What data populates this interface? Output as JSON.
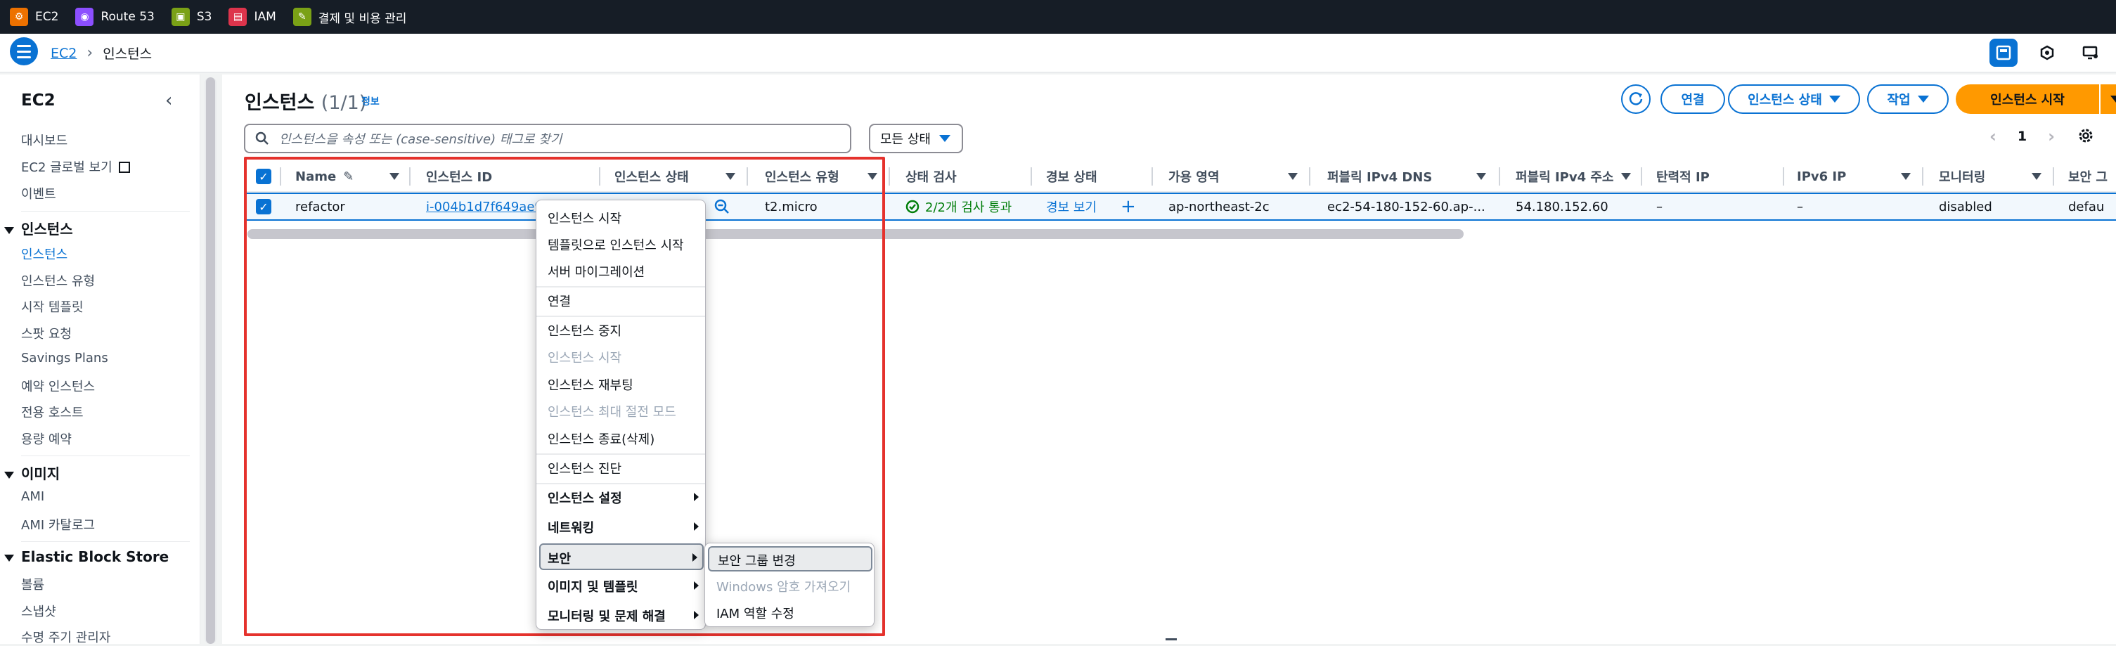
{
  "topbar": {
    "favorites": [
      {
        "label": "EC2",
        "icon": "ec2-icon",
        "color": "#ed7100"
      },
      {
        "label": "Route 53",
        "icon": "route53-icon",
        "color": "#8c4fff"
      },
      {
        "label": "S3",
        "icon": "s3-icon",
        "color": "#7aa116"
      },
      {
        "label": "IAM",
        "icon": "iam-icon",
        "color": "#dd344c"
      },
      {
        "label": "결제 및 비용 관리",
        "icon": "billing-icon",
        "color": "#7aa116"
      }
    ]
  },
  "breadcrumb": {
    "root": "EC2",
    "current": "인스턴스"
  },
  "sidebar": {
    "title": "EC2",
    "top_items": [
      "대시보드",
      "EC2 글로벌 보기",
      "이벤트"
    ],
    "sections": [
      {
        "header": "인스턴스",
        "items": [
          "인스턴스",
          "인스턴스 유형",
          "시작 템플릿",
          "스팟 요청",
          "Savings Plans",
          "예약 인스턴스",
          "전용 호스트",
          "용량 예약"
        ]
      },
      {
        "header": "이미지",
        "items": [
          "AMI",
          "AMI 카탈로그"
        ]
      },
      {
        "header": "Elastic Block Store",
        "items": [
          "볼륨",
          "스냅샷",
          "수명 주기 관리자"
        ]
      }
    ],
    "active": "인스턴스"
  },
  "main": {
    "title": "인스턴스",
    "count": "(1/1)",
    "info": "정보",
    "buttons": {
      "connect": "연결",
      "instance_state": "인스턴스 상태",
      "actions": "작업",
      "launch": "인스턴스 시작"
    },
    "search_placeholder": "인스턴스을 속성 또는 (case-sensitive) 태그로 찾기",
    "state_filter": "모든 상태",
    "page": "1"
  },
  "table": {
    "columns": [
      "Name",
      "인스턴스 ID",
      "인스턴스 상태",
      "인스턴스 유형",
      "상태 검사",
      "경보 상태",
      "가용 영역",
      "퍼블릭 IPv4 DNS",
      "퍼블릭 IPv4 주소",
      "탄력적 IP",
      "IPv6 IP",
      "모니터링",
      "보안 그"
    ],
    "rows": [
      {
        "name": "refactor",
        "instance_id": "i-004b1d7f649ae9",
        "type": "t2.micro",
        "status_check": "2/2개 검사 통과",
        "alarm": "경보 보기",
        "az": "ap-northeast-2c",
        "dns": "ec2-54-180-152-60.ap-...",
        "ipv4": "54.180.152.60",
        "eip": "–",
        "ipv6": "–",
        "monitoring": "disabled",
        "security": "defau"
      }
    ]
  },
  "context_menu": {
    "items": [
      {
        "label": "인스턴스 시작",
        "state": "enabled"
      },
      {
        "label": "템플릿으로 인스턴스 시작",
        "state": "enabled"
      },
      {
        "label": "서버 마이그레이션",
        "state": "enabled"
      },
      {
        "label": "연결",
        "state": "enabled"
      },
      {
        "label": "인스턴스 중지",
        "state": "enabled"
      },
      {
        "label": "인스턴스 시작",
        "state": "disabled"
      },
      {
        "label": "인스턴스 재부팅",
        "state": "enabled"
      },
      {
        "label": "인스턴스 최대 절전 모드",
        "state": "disabled"
      },
      {
        "label": "인스턴스 종료(삭제)",
        "state": "enabled"
      },
      {
        "label": "인스턴스 진단",
        "state": "enabled"
      },
      {
        "label": "인스턴스 설정",
        "state": "submenu"
      },
      {
        "label": "네트워킹",
        "state": "submenu"
      },
      {
        "label": "보안",
        "state": "submenu-open"
      },
      {
        "label": "이미지 및 템플릿",
        "state": "submenu"
      },
      {
        "label": "모니터링 및 문제 해결",
        "state": "submenu"
      }
    ],
    "security_submenu": [
      {
        "label": "보안 그룹 변경",
        "state": "highlighted"
      },
      {
        "label": "Windows 암호 가져오기",
        "state": "disabled"
      },
      {
        "label": "IAM 역할 수정",
        "state": "enabled"
      }
    ]
  },
  "colors": {
    "accent": "#0972d3",
    "primary": "#ff9900",
    "highlight_box": "#e5322d",
    "success": "#037f0c"
  }
}
